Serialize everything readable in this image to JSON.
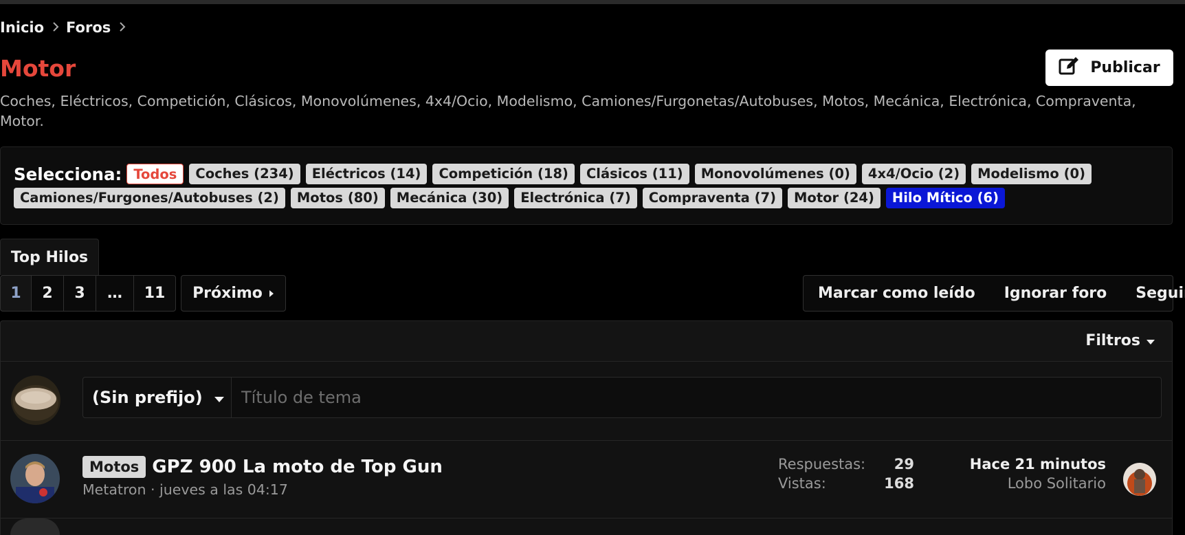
{
  "breadcrumb": {
    "home": "Inicio",
    "forums": "Foros"
  },
  "forum": {
    "title": "Motor",
    "description": "Coches, Eléctricos, Competición, Clásicos, Monovolúmenes, 4x4/Ocio, Modelismo, Camiones/Furgonetas/Autobuses, Motos, Mecánica, Electrónica, Compraventa, Motor.",
    "publish_label": "Publicar"
  },
  "selector": {
    "label": "Selecciona:",
    "row1": [
      "Todos",
      "Coches (234)",
      "Eléctricos (14)",
      "Competición (18)",
      "Clásicos (11)",
      "Monovolúmenes (0)",
      "4x4/Ocio (2)",
      "Modelismo (0)"
    ],
    "row2": [
      "Camiones/Furgones/Autobuses (2)",
      "Motos (80)",
      "Mecánica (30)",
      "Electrónica (7)",
      "Compraventa (7)",
      "Motor (24)",
      "Hilo Mítico (6)"
    ]
  },
  "tabs": {
    "top_threads": "Top Hilos"
  },
  "pagination": {
    "pages": [
      "1",
      "2",
      "3",
      "…",
      "11"
    ],
    "next_label": "Próximo"
  },
  "actions": {
    "mark_read": "Marcar como leído",
    "ignore": "Ignorar foro",
    "follow": "Seguir"
  },
  "filters": {
    "label": "Filtros"
  },
  "composer": {
    "prefix": "(Sin prefijo)",
    "placeholder": "Título de tema"
  },
  "thread": {
    "label": "Motos",
    "title": "GPZ 900 La moto de Top Gun",
    "author": "Metatron",
    "date": "jueves a las 04:17",
    "replies_label": "Respuestas:",
    "replies": "29",
    "views_label": "Vistas:",
    "views": "168",
    "last_time": "Hace 21 minutos",
    "last_user": "Lobo Solitario"
  },
  "colors": {
    "accent": "#e5473b",
    "highlight_chip": "#0a17d6",
    "background": "#000000"
  }
}
